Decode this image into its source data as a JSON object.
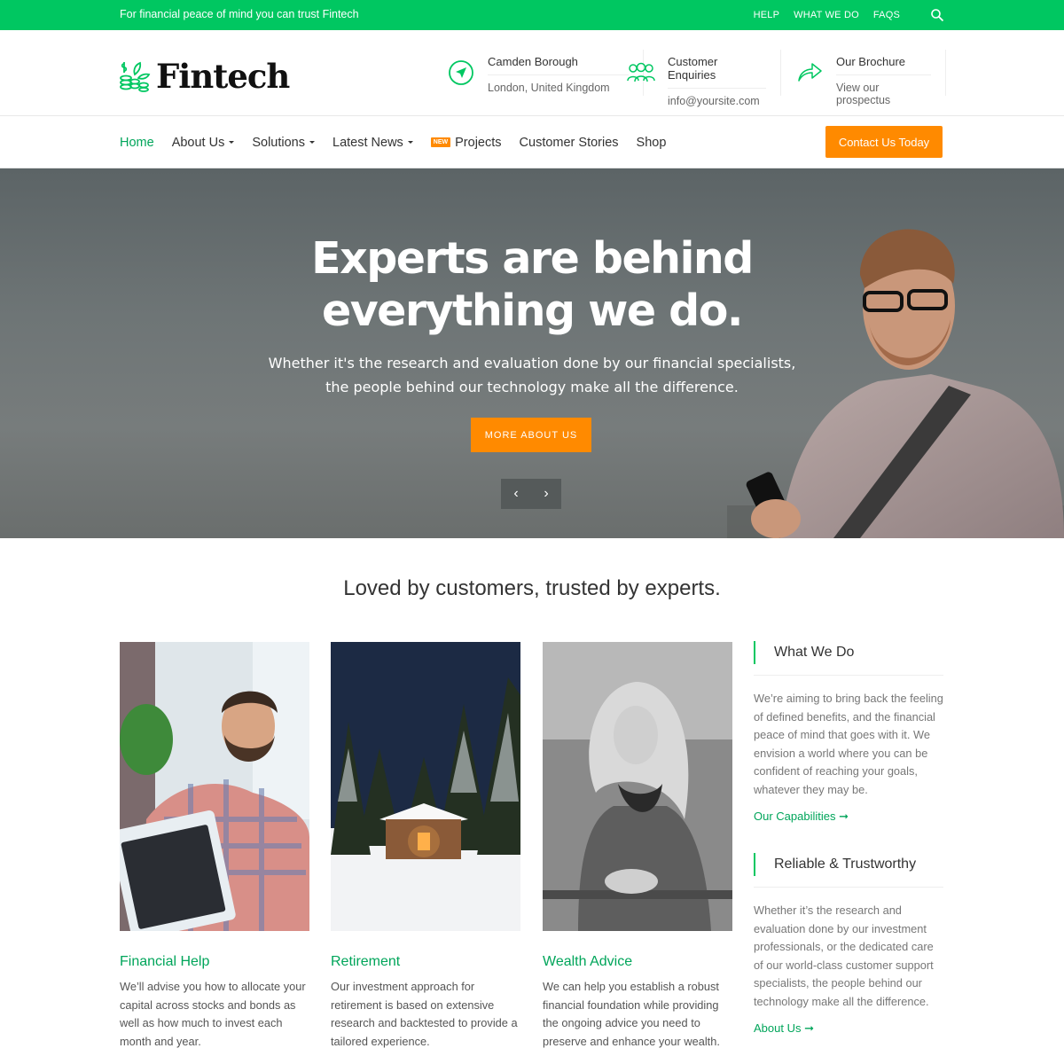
{
  "topbar": {
    "tagline": "For financial peace of mind you can trust Fintech",
    "links": [
      "HELP",
      "WHAT WE DO",
      "FAQS"
    ],
    "search_icon": "search-icon"
  },
  "brand": {
    "name": "Fintech",
    "accent": "#00c761",
    "orange": "#ff8a00"
  },
  "header_info": [
    {
      "icon": "navigation-arrow-icon",
      "title": "Camden Borough",
      "subtitle": "London, United Kingdom"
    },
    {
      "icon": "people-group-icon",
      "title": "Customer Enquiries",
      "subtitle": "info@yoursite.com"
    },
    {
      "icon": "share-arrow-icon",
      "title": "Our Brochure",
      "subtitle": "View our prospectus"
    }
  ],
  "nav": {
    "items": [
      {
        "label": "Home",
        "active": true
      },
      {
        "label": "About Us",
        "dropdown": true
      },
      {
        "label": "Solutions",
        "dropdown": true
      },
      {
        "label": "Latest News",
        "dropdown": true
      },
      {
        "label": "Projects",
        "badge": "NEW"
      },
      {
        "label": "Customer Stories"
      },
      {
        "label": "Shop"
      }
    ],
    "cta": "Contact Us Today"
  },
  "hero": {
    "headline_line1": "Experts are behind",
    "headline_line2": "everything we do.",
    "sub_line1": "Whether it's the research and evaluation done by our financial specialists,",
    "sub_line2": "the people behind our technology make all the difference.",
    "button": "MORE ABOUT US",
    "prev": "‹",
    "next": "›"
  },
  "section": {
    "title": "Loved by customers, trusted by experts."
  },
  "cards": [
    {
      "title": "Financial Help",
      "text": "We’ll advise you how to allocate your capital across stocks and bonds as well as how much to invest each month and year."
    },
    {
      "title": "Retirement",
      "text": "Our investment approach for retirement is based on extensive research and backtested to provide a tailored experience."
    },
    {
      "title": "Wealth Advice",
      "text": "We can help you establish a robust financial foundation while providing the ongoing advice you need to preserve and enhance your wealth."
    }
  ],
  "sidebar": [
    {
      "heading": "What We Do",
      "text": "We’re aiming to bring back the feeling of defined benefits, and the financial peace of mind that goes with it. We envision a world where you can be confident of reaching your goals, whatever they may be.",
      "link": "Our Capabilities ➞"
    },
    {
      "heading": "Reliable & Trustworthy",
      "text": "Whether it’s the research and evaluation done by our investment professionals, or the dedicated care of our world-class customer support specialists, the people behind our technology make all the difference.",
      "link": "About Us ➞"
    }
  ]
}
